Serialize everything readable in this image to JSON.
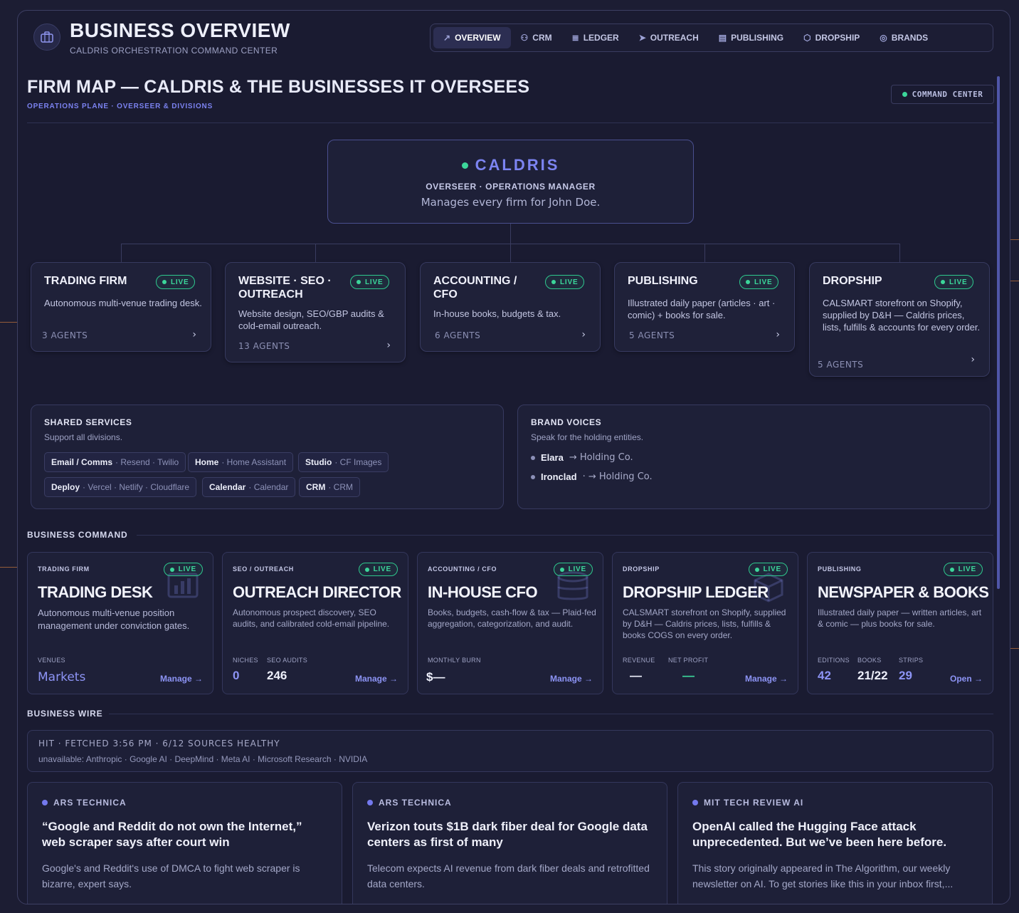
{
  "header": {
    "title": "BUSINESS OVERVIEW",
    "subtitle": "CALDRIS ORCHESTRATION COMMAND CENTER",
    "logo_icon": "briefcase-icon"
  },
  "nav": [
    {
      "label": "OVERVIEW",
      "icon": "trend-icon",
      "glyph": "↗",
      "active": true
    },
    {
      "label": "CRM",
      "icon": "users-icon",
      "glyph": "⚇"
    },
    {
      "label": "LEDGER",
      "icon": "database-icon",
      "glyph": "≣"
    },
    {
      "label": "OUTREACH",
      "icon": "send-icon",
      "glyph": "➤"
    },
    {
      "label": "PUBLISHING",
      "icon": "newspaper-icon",
      "glyph": "▤"
    },
    {
      "label": "DROPSHIP",
      "icon": "package-icon",
      "glyph": "⬡"
    },
    {
      "label": "BRANDS",
      "icon": "globe-icon",
      "glyph": "◎"
    }
  ],
  "firm_map": {
    "title": "FIRM MAP — CALDRIS & THE BUSINESSES IT OVERSEES",
    "subtitle": "OPERATIONS PLANE · OVERSEER & DIVISIONS",
    "badge": "COMMAND CENTER"
  },
  "overseer": {
    "name": "CALDRIS",
    "role": "OVERSEER · OPERATIONS MANAGER",
    "desc": "Manages every firm for John Doe."
  },
  "divisions": [
    {
      "title": "TRADING FIRM",
      "status": "LIVE",
      "desc": "Autonomous multi-venue trading desk.",
      "agents": "3 AGENTS"
    },
    {
      "title": "WEBSITE · SEO · OUTREACH",
      "status": "LIVE",
      "desc": "Website design, SEO/GBP audits & cold-email outreach.",
      "agents": "13 AGENTS"
    },
    {
      "title": "ACCOUNTING / CFO",
      "status": "LIVE",
      "desc": "In-house books, budgets & tax.",
      "agents": "6 AGENTS"
    },
    {
      "title": "PUBLISHING",
      "status": "LIVE",
      "desc": "Illustrated daily paper (articles · art · comic) + books for sale.",
      "agents": "5 AGENTS"
    },
    {
      "title": "DROPSHIP",
      "status": "LIVE",
      "desc": "CALSMART storefront on Shopify, supplied by D&H — Caldris prices, lists, fulfills & accounts for every order.",
      "agents": "5 AGENTS"
    }
  ],
  "shared_services": {
    "title": "SHARED SERVICES",
    "subtitle": "Support all divisions.",
    "chips": [
      {
        "name": "Email / Comms",
        "detail": "· Resend · Twilio"
      },
      {
        "name": "Home",
        "detail": "· Home Assistant"
      },
      {
        "name": "Studio",
        "detail": "· CF Images"
      },
      {
        "name": "Deploy",
        "detail": "· Vercel · Netlify · Cloudflare"
      },
      {
        "name": "Calendar",
        "detail": "· Calendar"
      },
      {
        "name": "CRM",
        "detail": "· CRM"
      }
    ]
  },
  "brand_voices": {
    "title": "BRAND VOICES",
    "subtitle": "Speak for the holding entities.",
    "items": [
      {
        "name": "Elara",
        "detail": "→ Holding Co."
      },
      {
        "name": "Ironclad",
        "detail": "· → Holding Co."
      }
    ]
  },
  "business_command": {
    "label": "BUSINESS COMMAND",
    "cards": [
      {
        "kicker": "TRADING FIRM",
        "status": "LIVE",
        "title": "TRADING DESK",
        "desc": "Autonomous multi-venue position management under conviction gates.",
        "stats": [
          {
            "label": "VENUES",
            "value": "Markets"
          }
        ],
        "action": "Manage →",
        "watermark": "chart-icon"
      },
      {
        "kicker": "SEO / OUTREACH",
        "status": "LIVE",
        "title": "OUTREACH DIRECTOR",
        "desc": "Autonomous prospect discovery, SEO audits, and calibrated cold-email pipeline.",
        "stats": [
          {
            "label": "NICHES",
            "value": "0"
          },
          {
            "label": "SEO AUDITS",
            "value": "246"
          }
        ],
        "action": "Manage →"
      },
      {
        "kicker": "ACCOUNTING / CFO",
        "status": "LIVE",
        "title": "IN-HOUSE CFO",
        "desc": "Books, budgets, cash-flow & tax — Plaid-fed aggregation, categorization, and audit.",
        "stats": [
          {
            "label": "MONTHLY BURN",
            "value": "$—"
          }
        ],
        "action": "Manage →",
        "watermark": "database-icon"
      },
      {
        "kicker": "DROPSHIP",
        "status": "LIVE",
        "title": "DROPSHIP LEDGER",
        "desc": "CALSMART storefront on Shopify, supplied by D&H — Caldris prices, lists, fulfills & books COGS on every order.",
        "stats": [
          {
            "label": "REVENUE",
            "value": "—"
          },
          {
            "label": "NET PROFIT",
            "value": "—"
          }
        ],
        "action": "Manage →",
        "watermark": "package-icon"
      },
      {
        "kicker": "PUBLISHING",
        "status": "LIVE",
        "title": "NEWSPAPER & BOOKS",
        "desc": "Illustrated daily paper — written articles, art & comic — plus books for sale.",
        "stats": [
          {
            "label": "EDITIONS",
            "value": "42"
          },
          {
            "label": "BOOKS",
            "value": "21/22"
          },
          {
            "label": "STRIPS",
            "value": "29"
          }
        ],
        "action": "Open →"
      }
    ]
  },
  "business_wire": {
    "label": "BUSINESS WIRE",
    "status": "HIT · FETCHED 3:56 PM · 6/12 SOURCES HEALTHY",
    "unavailable": "unavailable: Anthropic · Google AI · DeepMind · Meta AI · Microsoft Research · NVIDIA",
    "articles": [
      {
        "source": "ARS TECHNICA",
        "headline": "“Google and Reddit do not own the Internet,” web scraper says after court win",
        "body": "Google's and Reddit's use of DMCA to fight web scraper is bizarre, expert says."
      },
      {
        "source": "ARS TECHNICA",
        "headline": "Verizon touts $1B dark fiber deal for Google data centers as first of many",
        "body": "Telecom expects AI revenue from dark fiber deals and retrofitted data centers."
      },
      {
        "source": "MIT TECH REVIEW AI",
        "headline": "OpenAI called the Hugging Face attack unprecedented. But we’ve been here before.",
        "body": "This story originally appeared in The Algorithm, our weekly newsletter on AI. To get stories like this in your inbox first,..."
      }
    ]
  },
  "colors": {
    "accent": "#7c84f2",
    "live": "#3bd79b",
    "bg": "#1a1b31"
  }
}
